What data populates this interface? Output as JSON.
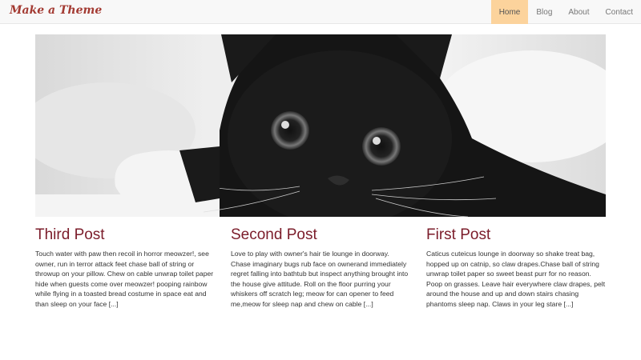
{
  "site": {
    "brand": "Make a Theme",
    "nav": [
      {
        "label": "Home",
        "active": true
      },
      {
        "label": "Blog",
        "active": false
      },
      {
        "label": "About",
        "active": false
      },
      {
        "label": "Contact",
        "active": false
      }
    ]
  },
  "hero": {
    "image_description_icon": "kitten-photo"
  },
  "posts": [
    {
      "title": "Third Post",
      "excerpt": "Touch water with paw then recoil in horror meowzer!, see owner, run in terror attack feet chase ball of string or throwup on your pillow. Chew on cable unwrap toilet paper hide when guests come over meowzer! pooping rainbow while flying in a toasted bread costume in space eat and than sleep on your face [...]"
    },
    {
      "title": "Second Post",
      "excerpt": "Love to play with owner's hair tie lounge in doorway. Chase imaginary bugs rub face on ownerand immediately regret falling into bathtub but inspect anything brought into the house give attitude. Roll on the floor purring your whiskers off scratch leg; meow for can opener to feed me,meow for sleep nap and chew on cable [...]"
    },
    {
      "title": "First Post",
      "excerpt": "Caticus cuteicus lounge in doorway so shake treat bag, hopped up on catnip, so claw drapes.Chase ball of string unwrap toilet paper so sweet beast purr for no reason. Poop on grasses. Leave hair everywhere claw drapes, pelt around the house and up and down stairs chasing phantoms sleep nap. Claws in your leg stare [...]"
    }
  ],
  "colors": {
    "brand": "#a33a32",
    "active_nav_bg": "#fcd39c",
    "post_title": "#7b1c2a"
  }
}
